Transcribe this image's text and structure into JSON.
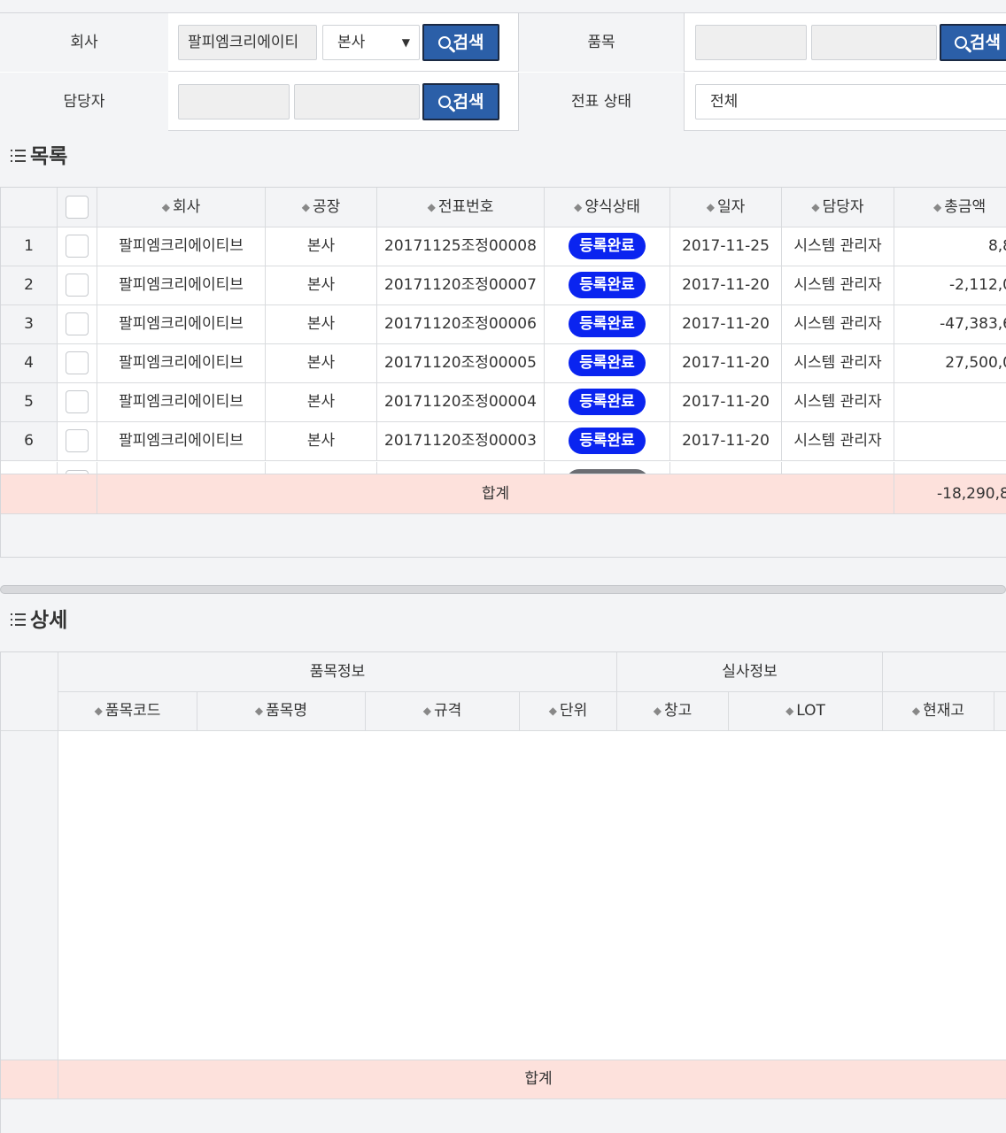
{
  "search": {
    "company_label": "회사",
    "company_value": "팔피엠크리에이티",
    "plant_value": "본사",
    "search_label": "검색",
    "item_label": "품목",
    "manager_label": "담당자",
    "status_label": "전표 상태",
    "status_value": "전체"
  },
  "list": {
    "title": "목록",
    "headers": [
      "회사",
      "공장",
      "전표번호",
      "양식상태",
      "일자",
      "담당자",
      "총금액"
    ],
    "rows": [
      {
        "no": "1",
        "company": "팔피엠크리에이티브",
        "plant": "본사",
        "doc": "20171125조정00008",
        "status": "등록완료",
        "date": "2017-11-25",
        "manager": "시스템 관리자",
        "amount": "8,8"
      },
      {
        "no": "2",
        "company": "팔피엠크리에이티브",
        "plant": "본사",
        "doc": "20171120조정00007",
        "status": "등록완료",
        "date": "2017-11-20",
        "manager": "시스템 관리자",
        "amount": "-2,112,0"
      },
      {
        "no": "3",
        "company": "팔피엠크리에이티브",
        "plant": "본사",
        "doc": "20171120조정00006",
        "status": "등록완료",
        "date": "2017-11-20",
        "manager": "시스템 관리자",
        "amount": "-47,383,6"
      },
      {
        "no": "4",
        "company": "팔피엠크리에이티브",
        "plant": "본사",
        "doc": "20171120조정00005",
        "status": "등록완료",
        "date": "2017-11-20",
        "manager": "시스템 관리자",
        "amount": "27,500,0"
      },
      {
        "no": "5",
        "company": "팔피엠크리에이티브",
        "plant": "본사",
        "doc": "20171120조정00004",
        "status": "등록완료",
        "date": "2017-11-20",
        "manager": "시스템 관리자",
        "amount": ""
      },
      {
        "no": "6",
        "company": "팔피엠크리에이티브",
        "plant": "본사",
        "doc": "20171120조정00003",
        "status": "등록완료",
        "date": "2017-11-20",
        "manager": "시스템 관리자",
        "amount": ""
      }
    ],
    "sum_label": "합계",
    "sum_amount": "-18,290,8"
  },
  "detail": {
    "title": "상세",
    "group_item": "품목정보",
    "group_actual": "실사정보",
    "headers": [
      "품목코드",
      "품목명",
      "규격",
      "단위",
      "창고",
      "LOT",
      "현재고"
    ],
    "sum_label": "합계"
  },
  "colors": {
    "badge": "#0a24f0",
    "search_button": "#2b5fa8",
    "sum_row": "#fde1dc"
  }
}
